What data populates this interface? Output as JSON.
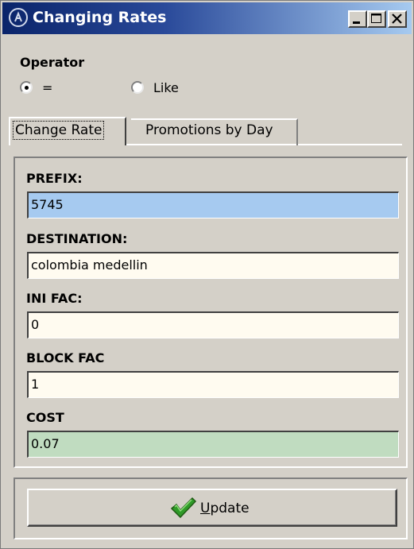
{
  "window": {
    "title": "Changing Rates",
    "app_icon": "app-logo-icon",
    "controls": [
      "minimize-icon",
      "maximize-icon",
      "close-icon"
    ]
  },
  "operator": {
    "label": "Operator",
    "options": [
      {
        "label": "=",
        "selected": true
      },
      {
        "label": "Like",
        "selected": false
      }
    ]
  },
  "tabs": [
    {
      "label": "Change Rate",
      "active": true
    },
    {
      "label": "Promotions by Day",
      "active": false
    }
  ],
  "form": {
    "prefix": {
      "label": "PREFIX:",
      "value": "5745",
      "bg": "#a6caf0"
    },
    "destination": {
      "label": "DESTINATION:",
      "value": "colombia medellin",
      "bg": "#fffbf0"
    },
    "ini_fac": {
      "label": "INI FAC:",
      "value": "0",
      "bg": "#fffbf0"
    },
    "block_fac": {
      "label": "BLOCK FAC",
      "value": "1",
      "bg": "#fffbf0"
    },
    "cost": {
      "label": "COST",
      "value": "0.07",
      "bg": "#c0dcc0"
    }
  },
  "update_button": {
    "mnemonic": "U",
    "rest": "pdate",
    "icon": "checkmark-icon"
  },
  "colors": {
    "window_bg": "#d4d0c8",
    "titlebar_start": "#0a246a",
    "titlebar_end": "#a6caf0"
  }
}
